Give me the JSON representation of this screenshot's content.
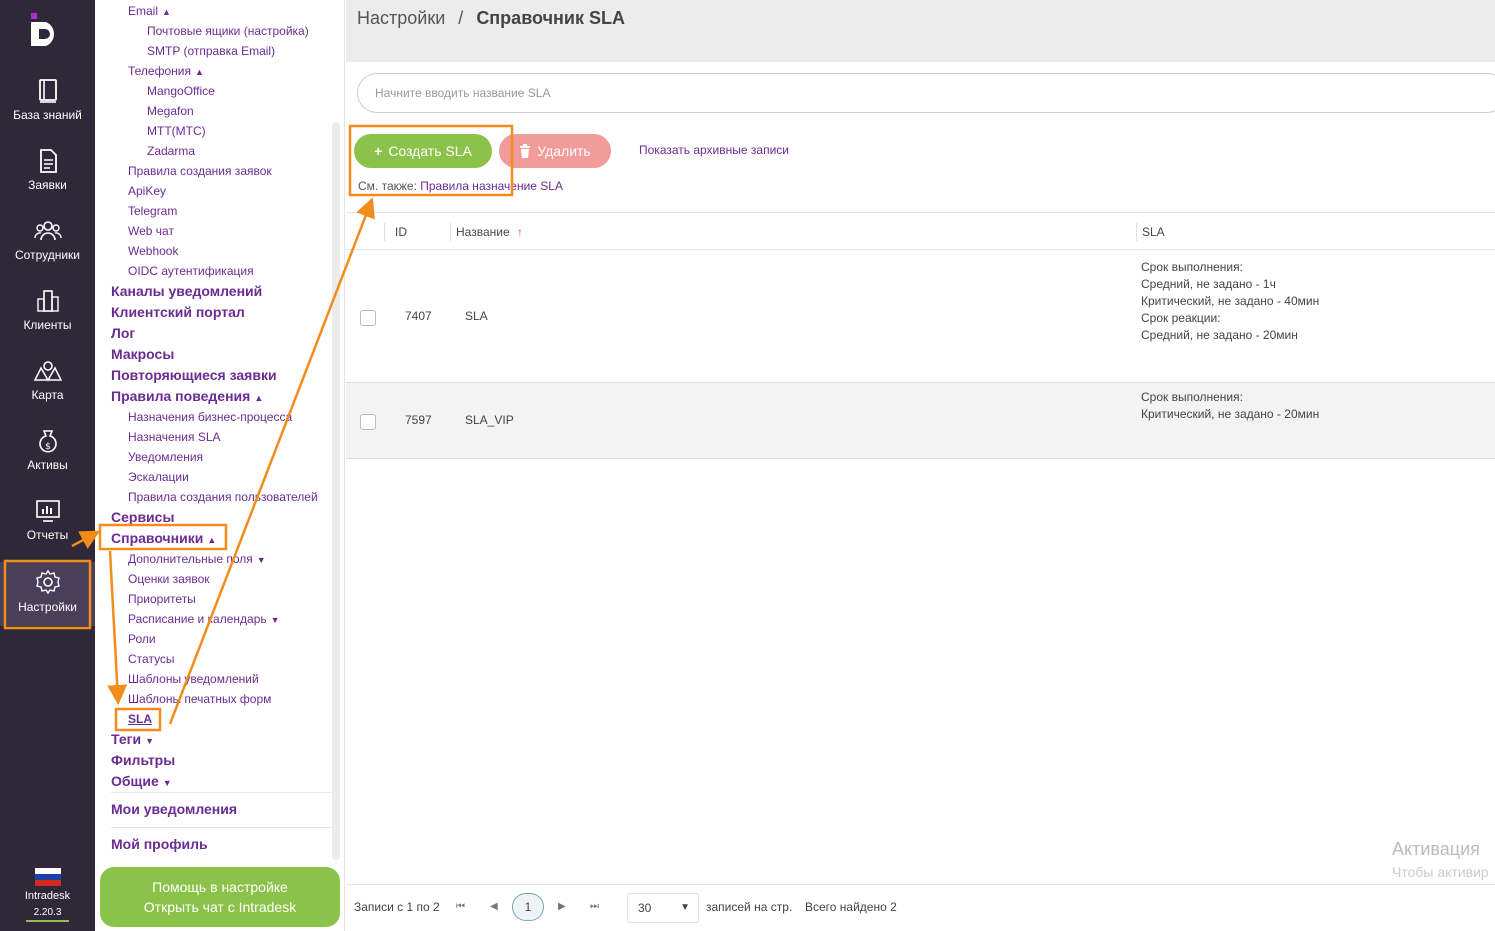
{
  "rail": {
    "items": [
      {
        "label": "База знаний"
      },
      {
        "label": "Заявки"
      },
      {
        "label": "Сотрудники"
      },
      {
        "label": "Клиенты"
      },
      {
        "label": "Карта"
      },
      {
        "label": "Активы"
      },
      {
        "label": "Отчеты"
      },
      {
        "label": "Настройки"
      }
    ],
    "brand": "Intradesk",
    "version": "2.20.3"
  },
  "menu": {
    "email": "Email",
    "mailboxes": "Почтовые ящики (настройка)",
    "smtp": "SMTP (отправка Email)",
    "telephony": "Телефония",
    "mango": "MangoOffice",
    "megafon": "Megafon",
    "mts": "МТТ(МТС)",
    "zadarma": "Zadarma",
    "ticket_rules": "Правила создания заявок",
    "apikey": "ApiKey",
    "telegram": "Telegram",
    "webchat": "Web чат",
    "webhook": "Webhook",
    "oidc": "OIDC аутентификация",
    "notify_channels": "Каналы уведомлений",
    "client_portal": "Клиентский портал",
    "log": "Лог",
    "macros": "Макросы",
    "recurring": "Повторяющиеся заявки",
    "behavior": "Правила поведения",
    "bp_assign": "Назначения бизнес-процесса",
    "sla_assign": "Назначения SLA",
    "notifications": "Уведомления",
    "escalations": "Эскалации",
    "user_rules": "Правила создания пользователей",
    "services": "Сервисы",
    "directories": "Справочники",
    "extra_fields": "Дополнительные поля",
    "ratings": "Оценки заявок",
    "priorities": "Приоритеты",
    "schedule": "Расписание и календарь",
    "roles": "Роли",
    "statuses": "Статусы",
    "notify_templates": "Шаблоны уведомлений",
    "print_templates": "Шаблоны печатных форм",
    "sla": "SLA",
    "tags": "Теги",
    "filters": "Фильтры",
    "general": "Общие",
    "my_notifications": "Мои уведомления",
    "my_profile": "Мой профиль",
    "help_line1": "Помощь в настройке",
    "help_line2": "Открыть чат с Intradesk"
  },
  "header": {
    "crumb_root": "Настройки",
    "crumb_sep": "/",
    "crumb_current": "Справочник SLA"
  },
  "search": {
    "placeholder": "Начните вводить название SLA"
  },
  "toolbar": {
    "create": "Создать SLA",
    "delete": "Удалить",
    "archive": "Показать архивные записи",
    "see_also": "См. также:",
    "see_also_link": "Правила назначение SLA"
  },
  "table": {
    "headers": {
      "id": "ID",
      "name": "Название",
      "sla": "SLA"
    },
    "rows": [
      {
        "id": "7407",
        "name": "SLA",
        "sla": [
          "Срок выполнения:",
          "Средний, не задано - 1ч",
          "Критический, не задано - 40мин",
          "Срок реакции:",
          "Средний, не задано - 20мин"
        ]
      },
      {
        "id": "7597",
        "name": "SLA_VIP",
        "sla": [
          "Срок выполнения:",
          "Критический, не задано - 20мин"
        ]
      }
    ]
  },
  "pager": {
    "records": "Записи с 1 по 2",
    "current": "1",
    "per_page": "30",
    "per_page_label": "записей на стр.",
    "total": "Всего найдено 2"
  },
  "watermark": {
    "line1": "Активация",
    "line2": "Чтобы активир"
  },
  "colors": {
    "rail": "#2e2838",
    "accent": "#8bc34a",
    "link": "#6b2c91",
    "highlight": "#f28c1a",
    "delete": "#f29b9b"
  }
}
